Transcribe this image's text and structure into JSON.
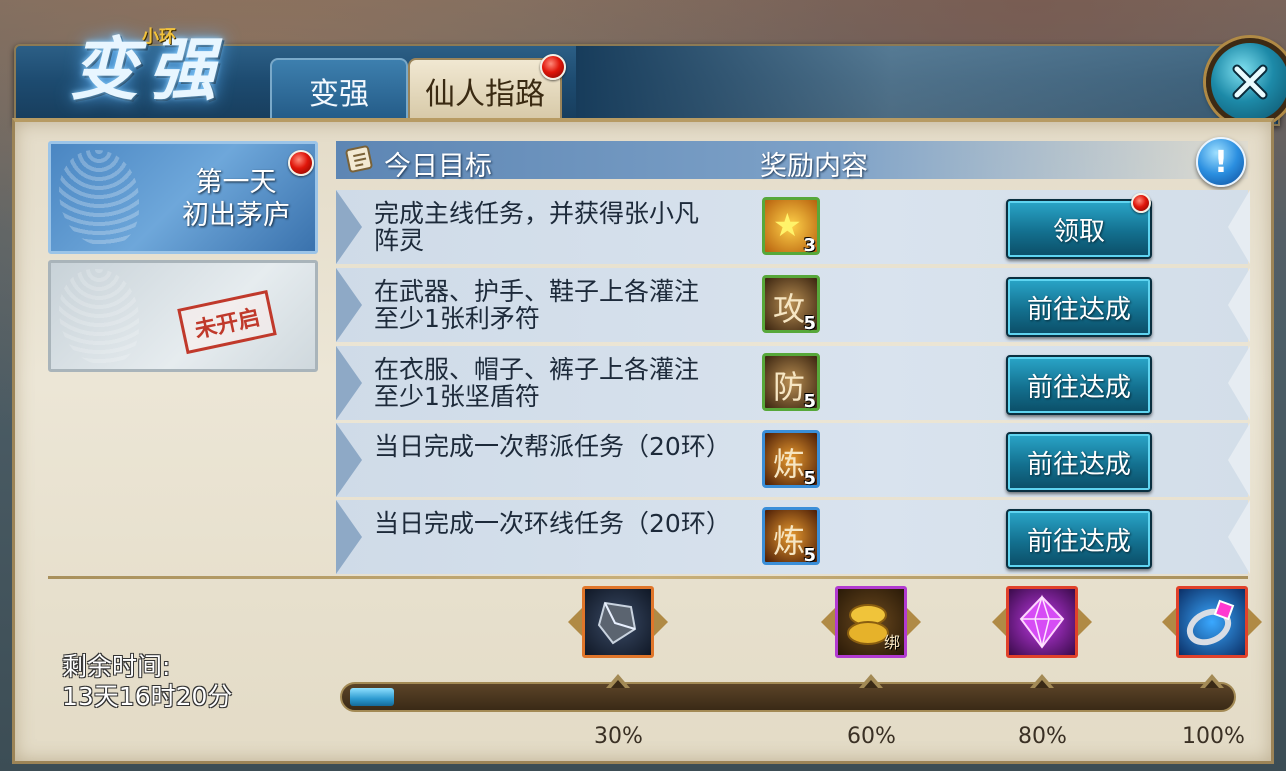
{
  "header": {
    "logo_text": "变强",
    "logo_subtitle": "小环",
    "tabs": [
      {
        "label": "变强",
        "active": false,
        "has_notice": false
      },
      {
        "label": "仙人指路",
        "active": true,
        "has_notice": true
      }
    ]
  },
  "days": [
    {
      "title_line1": "第一天",
      "title_line2": "初出茅庐",
      "active": true,
      "has_notice": true
    },
    {
      "stamp": "未开启",
      "active": false
    }
  ],
  "table": {
    "title": "今日目标",
    "reward_header": "奖励内容"
  },
  "tasks": [
    {
      "text": "完成主线任务，并获得张小凡阵灵",
      "reward_icon": "star-icon",
      "reward_glyph": "★",
      "reward_count": "3",
      "button": "领取",
      "has_notice": true
    },
    {
      "text": "在武器、护手、鞋子上各灌注至少1张利矛符",
      "reward_icon": "attack-scroll-icon",
      "reward_glyph": "攻",
      "reward_count": "5",
      "button": "前往达成",
      "has_notice": false
    },
    {
      "text": "在衣服、帽子、裤子上各灌注至少1张坚盾符",
      "reward_icon": "defense-scroll-icon",
      "reward_glyph": "防",
      "reward_count": "5",
      "button": "前往达成",
      "has_notice": false
    },
    {
      "text": "当日完成一次帮派任务（20环）",
      "reward_icon": "refine-talisman-icon",
      "reward_glyph": "炼",
      "reward_count": "5",
      "button": "前往达成",
      "has_notice": false
    },
    {
      "text": "当日完成一次环线任务（20环）",
      "reward_icon": "refine-talisman-icon",
      "reward_glyph": "炼",
      "reward_count": "5",
      "button": "前往达成",
      "has_notice": false
    }
  ],
  "remaining": {
    "label": "剩余时间:",
    "value": "13天16时20分"
  },
  "progress": {
    "fraction": 0.05,
    "milestones": [
      {
        "label": "30%",
        "value": 0.3,
        "icon": "crystal-shard-icon"
      },
      {
        "label": "60%",
        "value": 0.6,
        "icon": "gold-ingot-icon",
        "icon_text": "绑"
      },
      {
        "label": "80%",
        "value": 0.8,
        "icon": "purple-gem-icon"
      },
      {
        "label": "100%",
        "value": 1.0,
        "icon": "ring-icon"
      }
    ]
  },
  "colors": {
    "accent_blue": "#13708f",
    "notice_red": "#e0160a",
    "panel_parchment": "#ece6d6"
  }
}
